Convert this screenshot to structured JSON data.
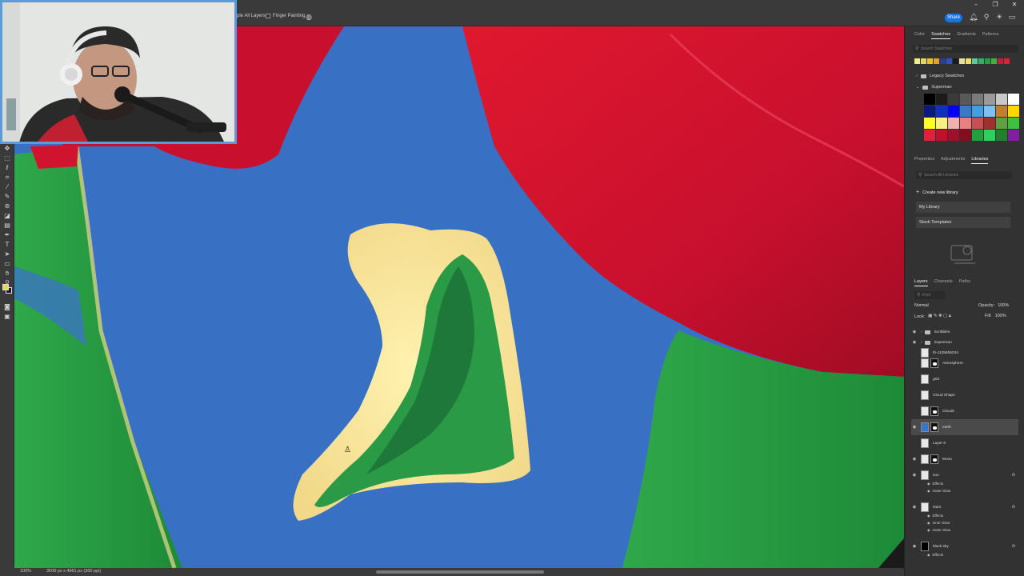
{
  "colors": {
    "accent": "#1473e6",
    "canvas_blue": "#3b74c8",
    "red": "#c8102e",
    "green": "#2fa84a",
    "sand": "#f2d98a",
    "webcam_border": "#5d9bd8"
  },
  "window": {
    "controls": [
      "minimize-icon",
      "restore-icon",
      "close-icon"
    ]
  },
  "options_bar": {
    "sample_all_layers": "ple All Layers",
    "finger_painting": "Finger Painting",
    "share_label": "Share",
    "icons": [
      "bell-icon",
      "search-icon",
      "lightbulb-icon",
      "workspace-icon"
    ]
  },
  "toolbar": {
    "tools": [
      "move-tool-icon",
      "marquee-tool-icon",
      "lasso-tool-icon",
      "crop-tool-icon",
      "eyedropper-tool-icon",
      "brush-tool-icon",
      "clone-tool-icon",
      "eraser-tool-icon",
      "gradient-tool-icon",
      "pen-tool-icon",
      "type-tool-icon",
      "path-select-tool-icon",
      "shape-tool-icon",
      "hand-tool-icon",
      "zoom-tool-icon"
    ],
    "foreground_color": "#e8d84a",
    "background_color": "#1b1b1b"
  },
  "status": {
    "zoom": "100%",
    "doc_info": "3508 px x 4961 px (300 ppi)"
  },
  "swatches_panel": {
    "tabs": [
      "Color",
      "Swatches",
      "Gradients",
      "Patterns"
    ],
    "active_tab": "Swatches",
    "search_placeholder": "Search Swatches",
    "recent": [
      "#f3ec8a",
      "#e8d45a",
      "#f0c020",
      "#e8a020",
      "#2b3c9a",
      "#3050c8",
      "#1b1b1b",
      "#e6e0a0",
      "#f0e060",
      "#60c8a0",
      "#30b060",
      "#20a040",
      "#40b040",
      "#c02040",
      "#e02030"
    ],
    "folders": [
      "Legacy Swatches",
      "Superman"
    ],
    "grid": [
      "#000000",
      "#1b1b1b",
      "#3a3a3a",
      "#595959",
      "#7a7a7a",
      "#9a9a9a",
      "#c8c8c8",
      "#ffffff",
      "#0a1a80",
      "#1030c0",
      "#0000ff",
      "#3a78c8",
      "#40a0e0",
      "#80c0f0",
      "#c08030",
      "#ffd700",
      "#ffff20",
      "#f8f080",
      "#f0b0b0",
      "#e88080",
      "#c85050",
      "#a03030",
      "#60a040",
      "#40c040",
      "#e02040",
      "#c01030",
      "#a01028",
      "#801020",
      "#20a040",
      "#30d060",
      "#208030",
      "#8020a0"
    ]
  },
  "libraries_panel": {
    "tabs": [
      "Properties",
      "Adjustments",
      "Libraries"
    ],
    "active_tab": "Libraries",
    "search_placeholder": "Search All Libraries",
    "create_label": "Create new library",
    "items": [
      "My Library",
      "Stock Templates"
    ]
  },
  "layers_panel": {
    "tabs": [
      "Layers",
      "Channels",
      "Paths"
    ],
    "active_tab": "Layers",
    "filter_kind": "Kind",
    "blend_mode": "Normal",
    "opacity_label": "Opacity:",
    "opacity_value": "100%",
    "lock_label": "Lock:",
    "fill_label": "Fill:",
    "fill_value": "100%",
    "layers": [
      {
        "name": "Scribbles",
        "type": "folder",
        "visible": true
      },
      {
        "name": "Superman",
        "type": "folder",
        "visible": true
      },
      {
        "name": "th-1139655034",
        "type": "image",
        "visible": false
      },
      {
        "name": "Atmosphere",
        "type": "masked",
        "visible": false
      },
      {
        "name": "grid",
        "type": "plain",
        "visible": false
      },
      {
        "name": "Cloud Shape",
        "type": "plain",
        "visible": false
      },
      {
        "name": "Clouds",
        "type": "masked",
        "visible": false
      },
      {
        "name": "earth",
        "type": "masked",
        "visible": true,
        "selected": true
      },
      {
        "name": "Layer 6",
        "type": "plain",
        "visible": false
      },
      {
        "name": "Moon",
        "type": "masked",
        "visible": true
      },
      {
        "name": "sun",
        "type": "plain",
        "visible": true,
        "fx": true
      },
      {
        "name": "stars",
        "type": "plain",
        "visible": true,
        "fx": true
      },
      {
        "name": "black sky",
        "type": "black",
        "visible": true,
        "fx": true
      }
    ],
    "effects": {
      "sun": [
        "Effects",
        "Outer Glow"
      ],
      "stars": [
        "Effects",
        "Inner Glow",
        "Outer Glow"
      ],
      "black_sky": [
        "Effects"
      ]
    }
  }
}
